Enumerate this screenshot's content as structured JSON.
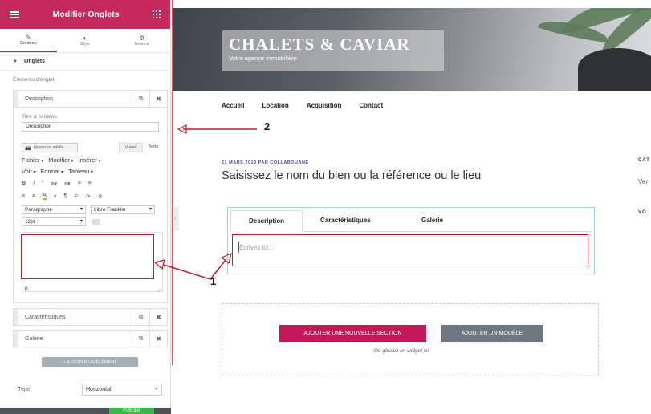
{
  "sidebar": {
    "title": "Modifier Onglets",
    "tabs": [
      {
        "label": "Contenu",
        "icon": "pencil-icon"
      },
      {
        "label": "Style",
        "icon": "contrast-icon"
      },
      {
        "label": "Avancé",
        "icon": "gear-icon"
      }
    ],
    "section_title": "Onglets",
    "items_label": "Éléments d'onglet",
    "items": [
      {
        "label": "Description"
      },
      {
        "label": "Caractéristiques"
      },
      {
        "label": "Galerie"
      }
    ],
    "editor": {
      "title_field_label": "Titre & contenu",
      "title_value": "Description",
      "media_button": "Ajouter un média",
      "mode_visual": "Visuel",
      "mode_text": "Texte",
      "menu_file": "Fichier",
      "menu_edit": "Modifier",
      "menu_insert": "Insérer",
      "menu_view": "Voir",
      "menu_format": "Format",
      "menu_table": "Tableau",
      "paragraph_select": "Paragraphe",
      "font_select": "Libre Franklin",
      "size_select": "12pt",
      "status_tag": "p"
    },
    "add_item_button": "+ AJOUTER UN ÉLÉMENT",
    "type_label": "Type",
    "type_value": "Horizontal",
    "publish_label": "PUBLIER"
  },
  "site": {
    "title": "CHALETS & CAVIAR",
    "tagline": "Votre agence immobilière",
    "nav": [
      "Accueil",
      "Location",
      "Acquisition",
      "Contact"
    ]
  },
  "post": {
    "meta": "21 MARS 2018 PAR COLLABOUANE",
    "title": "Saisissez le nom du bien ou la référence ou le lieu"
  },
  "side": {
    "cat": "CAT",
    "ver": "Ver",
    "vo": "VO"
  },
  "tabs_widget": {
    "tabs": [
      "Description",
      "Caractéristiques",
      "Galerie"
    ],
    "placeholder": "Écrivez ici..."
  },
  "dropzone": {
    "new_section": "AJOUTER UNE NOUVELLE SECTION",
    "add_model": "AJOUTER UN MODÈLE",
    "hint": "Ou glissez un widget ici"
  },
  "annotations": {
    "one": "1",
    "two": "2"
  },
  "colors": {
    "brand": "#c4285c",
    "highlight": "#c21e2e",
    "publish": "#39b54a"
  }
}
